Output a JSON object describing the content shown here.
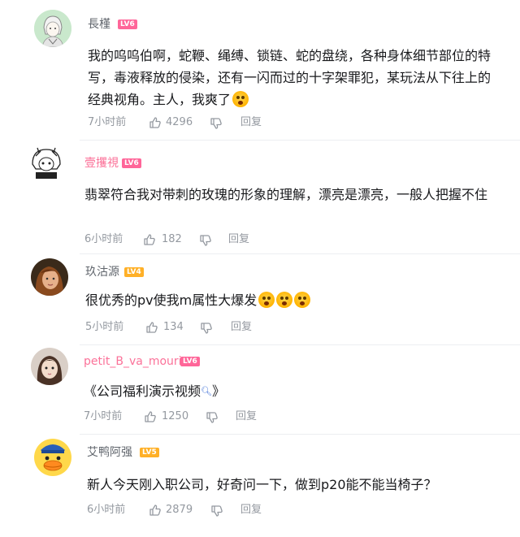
{
  "colors": {
    "lv6": "#ff6699",
    "lv5": "#ffb027",
    "lv4": "#ffb027",
    "username_default": "#61666d",
    "username_red": "#fb7299",
    "meta": "#9499a0",
    "text": "#18191c"
  },
  "comments": [
    {
      "username": "長槿",
      "level": "LV6",
      "text": "我的呜呜伯啊，蛇鞭、绳缚、锁链、蛇的盘绕，各种身体细节部位的特写，毒液释放的侵染，还有一闪而过的十字架罪犯，某玩法从下往上的经典视角。主人，我爽了",
      "emoji_count": 1,
      "time": "7小时前",
      "likes": "4296",
      "reply": "回复",
      "avatar_icon": "anime-character-avatar"
    },
    {
      "username": "壹攫視",
      "level": "LV6",
      "text": "翡翠符合我对带刺的玫瑰的形象的理解，漂亮是漂亮，一般人把握不住",
      "emoji_count": 0,
      "time": "6小时前",
      "likes": "182",
      "reply": "回复",
      "avatar_icon": "chibi-character-avatar"
    },
    {
      "username": "玖沽源",
      "level": "LV4",
      "text": "很优秀的pv使我m属性大爆发",
      "emoji_count": 3,
      "time": "5小时前",
      "likes": "134",
      "reply": "回复",
      "avatar_icon": "portrait-avatar"
    },
    {
      "username": "petit_B_va_mouri",
      "level": "LV6",
      "text": "《公司福利演示视频",
      "text_suffix": "》",
      "search_icon": "search-icon",
      "emoji_count": 0,
      "time": "7小时前",
      "likes": "1250",
      "reply": "回复",
      "avatar_icon": "girl-avatar"
    },
    {
      "username": "艾鸭阿强",
      "level": "LV5",
      "text": "新人今天刚入职公司，好奇问一下，做到p20能不能当椅子？",
      "emoji_count": 0,
      "time": "6小时前",
      "likes": "2879",
      "reply": "回复",
      "avatar_icon": "duck-avatar"
    }
  ]
}
